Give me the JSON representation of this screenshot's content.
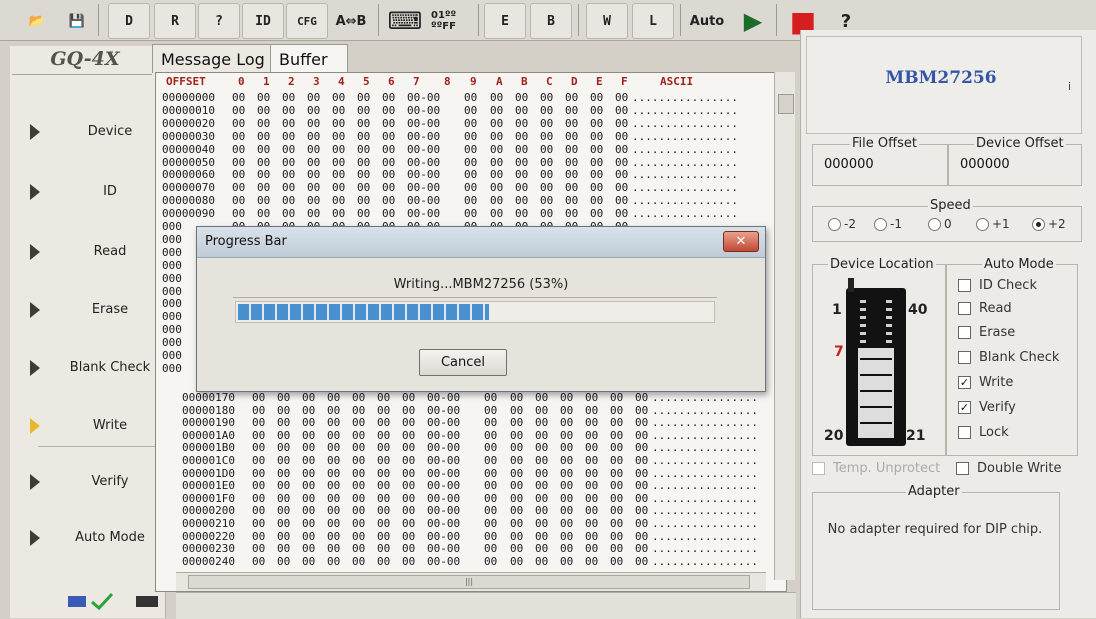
{
  "toolbar": {
    "buttons": [
      {
        "name": "open-file-button",
        "icon": "folder-open-icon",
        "label": "📂"
      },
      {
        "name": "save-file-button",
        "icon": "floppy-disk-icon",
        "label": "💾"
      },
      {
        "name": "device-button",
        "icon": "chip-d-icon",
        "label": "D"
      },
      {
        "name": "read-button",
        "icon": "chip-r-icon",
        "label": "R"
      },
      {
        "name": "blank-check-button",
        "icon": "chip-question-icon",
        "label": "?"
      },
      {
        "name": "id-button",
        "icon": "chip-id-icon",
        "label": "ID"
      },
      {
        "name": "checksum-button",
        "icon": "chip-cfg-icon",
        "label": "CFG"
      },
      {
        "name": "compare-button",
        "icon": "compare-icon",
        "label": "A⇔B"
      },
      {
        "name": "keyboard-button",
        "icon": "keyboard-icon",
        "label": "⌨"
      },
      {
        "name": "fill-button",
        "icon": "binary-ff-icon",
        "label": "01ºº ººFF"
      },
      {
        "name": "erase-button",
        "icon": "chip-e-icon",
        "label": "E"
      },
      {
        "name": "blank-button",
        "icon": "chip-b-icon",
        "label": "B"
      },
      {
        "name": "write-button",
        "icon": "chip-w-icon",
        "label": "W"
      },
      {
        "name": "lock-button",
        "icon": "chip-l-icon",
        "label": "L"
      },
      {
        "name": "auto-button",
        "icon": "auto-icon",
        "label": "Auto"
      },
      {
        "name": "run-button",
        "icon": "play-icon",
        "label": "▶"
      },
      {
        "name": "stop-button",
        "icon": "stop-icon",
        "label": "■"
      },
      {
        "name": "help-button",
        "icon": "help-icon",
        "label": "?"
      }
    ]
  },
  "brand": "GQ-4X",
  "nav": [
    {
      "label": "Device"
    },
    {
      "label": "ID"
    },
    {
      "label": "Read"
    },
    {
      "label": "Erase"
    },
    {
      "label": "Blank Check"
    },
    {
      "label": "Write"
    },
    {
      "label": "Verify"
    },
    {
      "label": "Auto Mode"
    }
  ],
  "tabs": [
    "Message Log",
    "Buffer"
  ],
  "hex": {
    "header": {
      "offset": "OFFSET",
      "cols": [
        "0",
        "1",
        "2",
        "3",
        "4",
        "5",
        "6",
        "7",
        "8",
        "9",
        "A",
        "B",
        "C",
        "D",
        "E",
        "F"
      ],
      "ascii": "ASCII"
    },
    "rows_top": [
      "00000000",
      "00000010",
      "00000020",
      "00000030",
      "00000040",
      "00000050",
      "00000060",
      "00000070",
      "00000080",
      "00000090"
    ],
    "rows_hidden": [
      "000",
      "000",
      "000",
      "000",
      "000",
      "000",
      "000",
      "000",
      "000",
      "000",
      "000",
      "000"
    ],
    "rows_bottom": [
      "00000170",
      "00000180",
      "00000190",
      "000001A0",
      "000001B0",
      "000001C0",
      "000001D0",
      "000001E0",
      "000001F0",
      "00000200",
      "00000210",
      "00000220",
      "00000230",
      "00000240"
    ],
    "byte": "00",
    "mid_byte": "00-00",
    "ascii_fill": "................"
  },
  "scroll": {
    "hthumb": "|||"
  },
  "dialog": {
    "title": "Progress Bar",
    "close": "✕",
    "message": "Writing...MBM27256 (53%)",
    "progress_pct": 53,
    "cancel": "Cancel"
  },
  "device": {
    "name": "MBM27256",
    "side_mark": "i"
  },
  "offsets": {
    "file_label": "File Offset",
    "file_value": "000000",
    "device_label": "Device Offset",
    "device_value": "000000"
  },
  "speed": {
    "label": "Speed",
    "options": [
      "-2",
      "-1",
      "0",
      "+1",
      "+2"
    ],
    "selected": "+2"
  },
  "location": {
    "label": "Device Location",
    "pin1": "1",
    "pin40": "40",
    "pin7": "7",
    "pin20": "20",
    "pin21": "21"
  },
  "auto_mode": {
    "label": "Auto Mode",
    "items": [
      {
        "label": "ID Check",
        "checked": false
      },
      {
        "label": "Read",
        "checked": false
      },
      {
        "label": "Erase",
        "checked": false
      },
      {
        "label": "Blank Check",
        "checked": false
      },
      {
        "label": "Write",
        "checked": true
      },
      {
        "label": "Verify",
        "checked": true
      },
      {
        "label": "Lock",
        "checked": false
      }
    ]
  },
  "temp_unprotect": "Temp. Unprotect",
  "double_write": "Double Write",
  "adapter": {
    "label": "Adapter",
    "text": "No adapter required for DIP chip."
  },
  "colors": {
    "accent": "#3555a8",
    "progress": "#4a90cf",
    "offset_header": "#a4201c",
    "pin7": "#c0231c"
  }
}
